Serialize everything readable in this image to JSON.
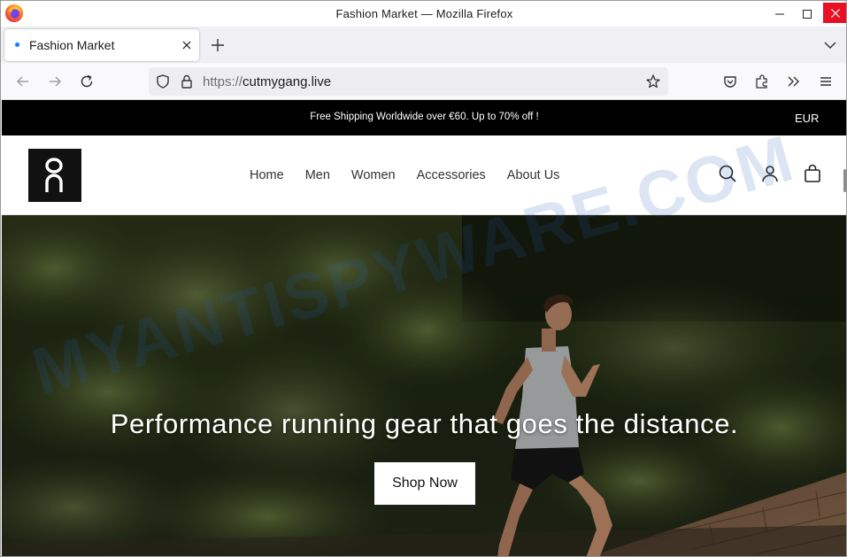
{
  "window": {
    "title": "Fashion Market — Mozilla Firefox"
  },
  "tab": {
    "label": "Fashion Market"
  },
  "urlbar": {
    "scheme": "https://",
    "host": "cutmygang.live"
  },
  "site": {
    "announcement": "Free Shipping Worldwide over €60. Up to 70% off !",
    "currency": "EUR",
    "logo_text": "on",
    "menu": [
      "Home",
      "Men",
      "Women",
      "Accessories",
      "About Us"
    ],
    "hero": {
      "headline": "Performance running gear that goes the distance.",
      "cta": "Shop Now"
    }
  },
  "watermark": "MYANTISPYWARE.COM",
  "colors": {
    "close_red": "#e81123",
    "announce_bg": "#000000",
    "tab_dot": "#0a84ff"
  },
  "icons": [
    "firefox-logo-icon",
    "minimize-icon",
    "maximize-icon",
    "close-icon",
    "tab-close-icon",
    "new-tab-icon",
    "tab-list-icon",
    "back-icon",
    "forward-icon",
    "reload-icon",
    "tracking-shield-icon",
    "lock-icon",
    "bookmark-star-icon",
    "pocket-icon",
    "extensions-icon",
    "overflow-icon",
    "menu-icon",
    "search-icon",
    "account-icon",
    "bag-icon"
  ]
}
